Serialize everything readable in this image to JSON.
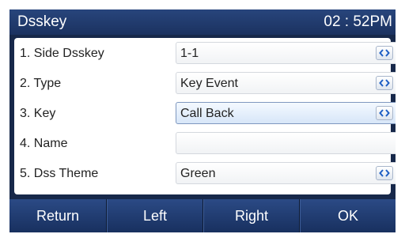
{
  "titlebar": {
    "title": "Dsskey",
    "clock": "02 : 52PM"
  },
  "rows": [
    {
      "label": "1. Side Dsskey",
      "value": "1-1",
      "has_toggle": true,
      "focused": false
    },
    {
      "label": "2. Type",
      "value": "Key Event",
      "has_toggle": true,
      "focused": false
    },
    {
      "label": "3. Key",
      "value": "Call Back",
      "has_toggle": true,
      "focused": true
    },
    {
      "label": "4. Name",
      "value": "",
      "has_toggle": false,
      "focused": false
    },
    {
      "label": "5. Dss Theme",
      "value": "Green",
      "has_toggle": true,
      "focused": false
    }
  ],
  "softkeys": {
    "return": "Return",
    "left": "Left",
    "right": "Right",
    "ok": "OK"
  },
  "icons": {
    "toggle": "left-right-arrows-icon"
  },
  "colors": {
    "background": "#17284a",
    "accent": "#2e57a8",
    "focus_field": "#d7e6f8"
  }
}
